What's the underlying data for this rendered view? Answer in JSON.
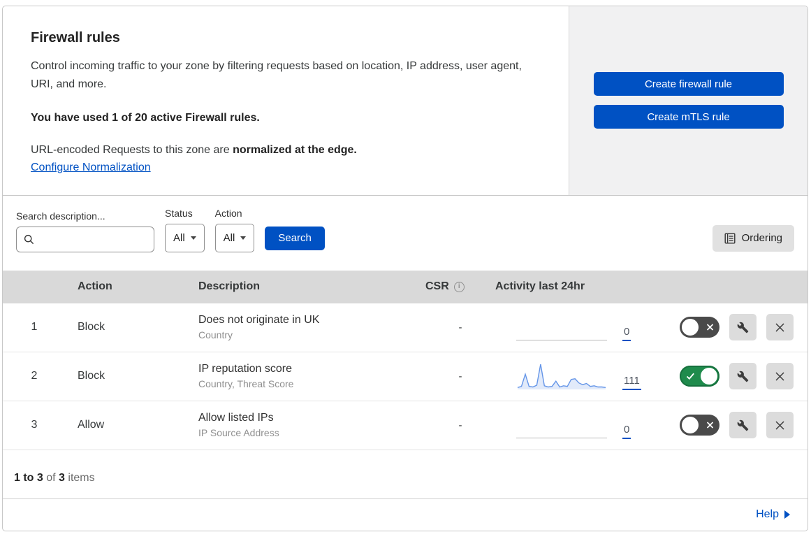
{
  "header": {
    "title": "Firewall rules",
    "description": "Control incoming traffic to your zone by filtering requests based on location, IP address, user agent, URI, and more.",
    "usage_bold": "You have used 1 of 20 active Firewall rules.",
    "normalization_prefix": "URL-encoded Requests to this zone are ",
    "normalization_bold": "normalized at the edge.",
    "normalization_link": "Configure Normalization",
    "create_firewall_button": "Create firewall rule",
    "create_mtls_button": "Create mTLS rule"
  },
  "filters": {
    "search_label": "Search description...",
    "status_label": "Status",
    "status_value": "All",
    "action_label": "Action",
    "action_value": "All",
    "search_button": "Search",
    "ordering_button": "Ordering"
  },
  "table": {
    "columns": {
      "action": "Action",
      "description": "Description",
      "csr": "CSR",
      "activity": "Activity last 24hr"
    },
    "rows": [
      {
        "priority": "1",
        "action": "Block",
        "description": "Does not originate in UK",
        "fields": "Country",
        "csr": "-",
        "activity_count": "0",
        "enabled": false,
        "has_sparkline": false
      },
      {
        "priority": "2",
        "action": "Block",
        "description": "IP reputation score",
        "fields": "Country, Threat Score",
        "csr": "-",
        "activity_count": "111",
        "enabled": true,
        "has_sparkline": true
      },
      {
        "priority": "3",
        "action": "Allow",
        "description": "Allow listed IPs",
        "fields": "IP Source Address",
        "csr": "-",
        "activity_count": "0",
        "enabled": false,
        "has_sparkline": false
      }
    ],
    "sparkline": {
      "values": [
        2,
        4,
        25,
        4,
        3,
        6,
        42,
        5,
        3,
        4,
        13,
        3,
        5,
        4,
        16,
        17,
        10,
        7,
        9,
        4,
        5,
        3,
        3,
        2
      ],
      "stroke": "#6495e8",
      "fill": "#e1eafa"
    }
  },
  "footer": {
    "range_bold": "1 to 3",
    "of_text": "of",
    "total_bold": "3",
    "items_text": "items",
    "help_label": "Help"
  },
  "icons": {
    "info": "i"
  },
  "colors": {
    "primary_blue": "#0051c3",
    "toggle_on": "#1f8b4c",
    "toggle_off": "#4a4a4a",
    "table_header_bg": "#d9d9d9",
    "side_panel_bg": "#f1f1f2"
  }
}
